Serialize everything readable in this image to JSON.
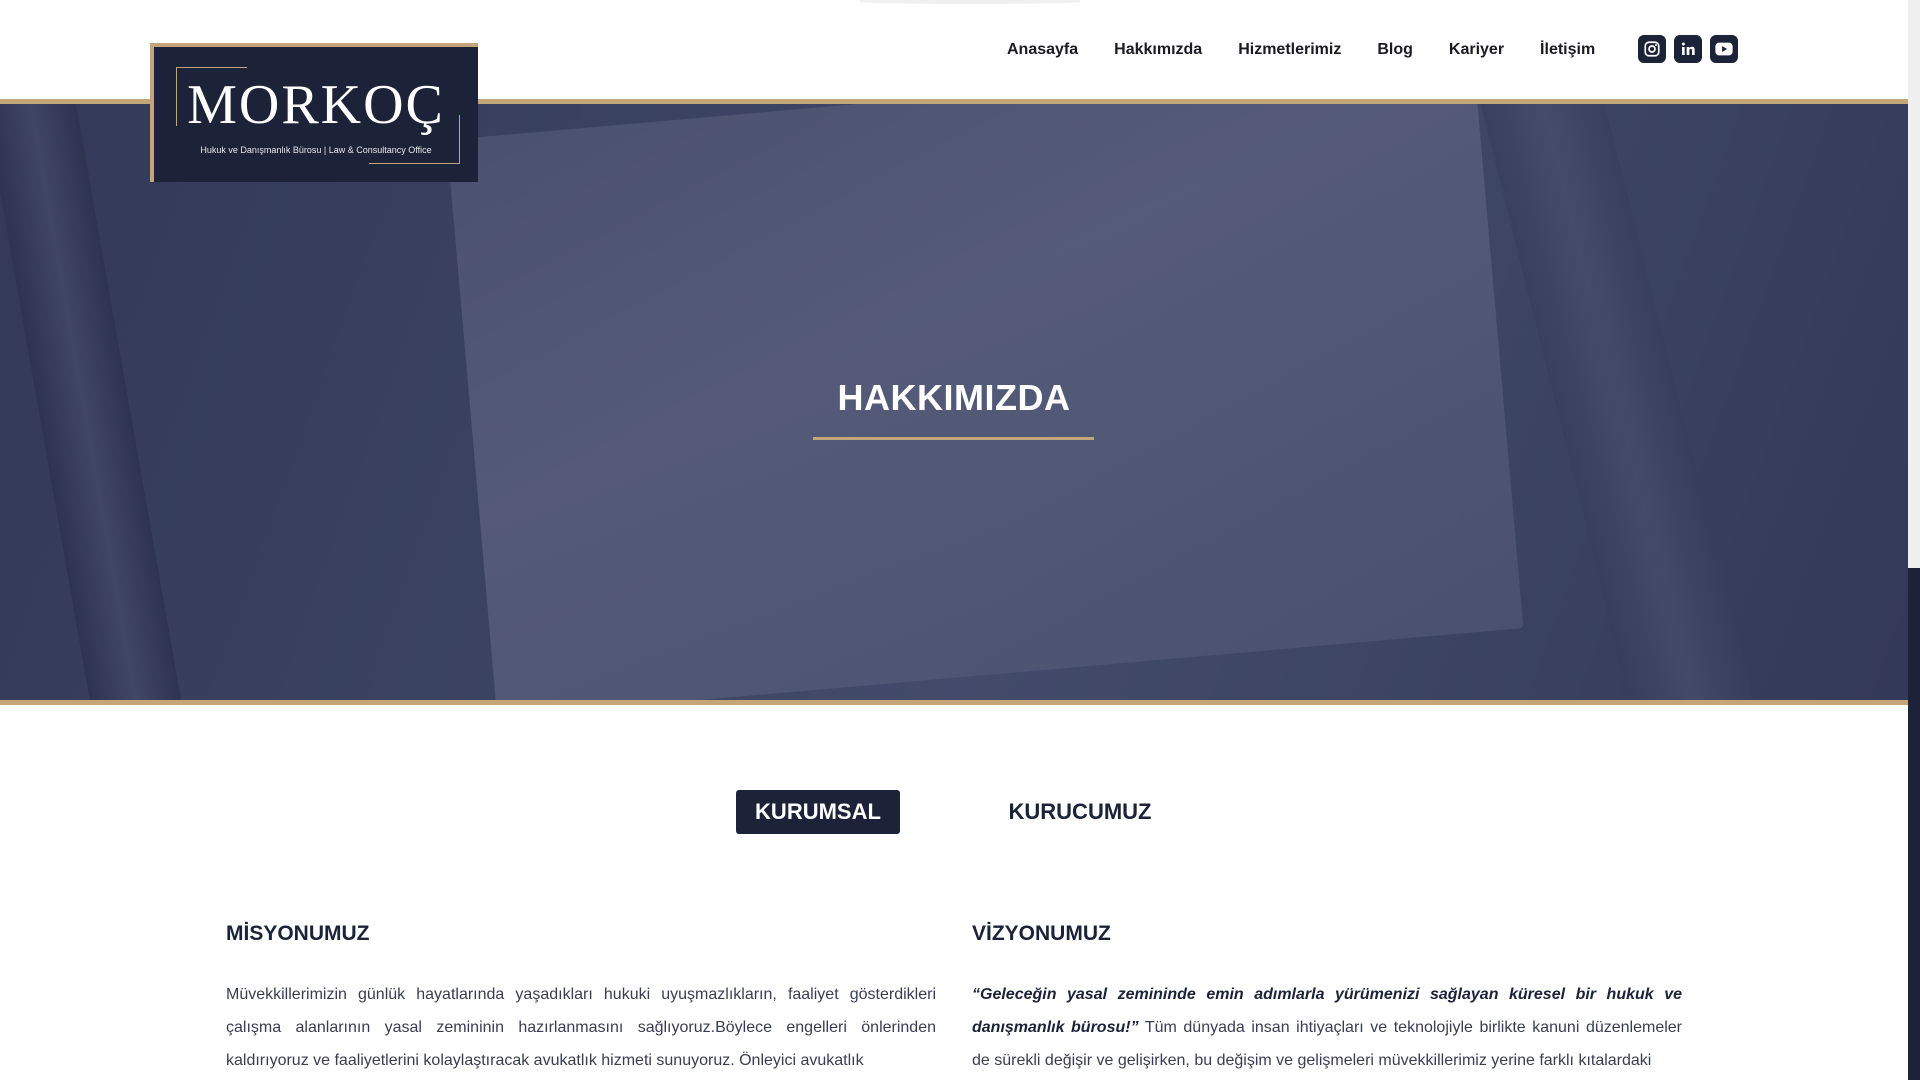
{
  "logo": {
    "name": "MORKOÇ",
    "subtitle": "Hukuk ve Danışmanlık Bürosu | Law & Consultancy Office"
  },
  "nav": {
    "items": [
      {
        "label": "Anasayfa"
      },
      {
        "label": "Hakkımızda"
      },
      {
        "label": "Hizmetlerimiz"
      },
      {
        "label": "Blog"
      },
      {
        "label": "Kariyer"
      },
      {
        "label": "İletişim"
      }
    ]
  },
  "socials": {
    "icons": [
      "instagram-icon",
      "linkedin-icon",
      "youtube-icon"
    ]
  },
  "hero": {
    "title": "HAKKIMIZDA"
  },
  "tabs": {
    "active": "KURUMSAL",
    "inactive": "KURUCUMUZ"
  },
  "mission": {
    "title": "MİSYONUMUZ",
    "text": "Müvekkillerimizin günlük hayatlarında yaşadıkları hukuki uyuşmazlıkların, faaliyet gösterdikleri çalışma alanlarının yasal zemininin hazırlanmasını sağlıyoruz.Böylece engelleri önlerinden kaldırıyoruz ve faaliyetlerini kolaylaştıracak avukatlık hizmeti sunuyoruz. Önleyici avukatlık"
  },
  "vision": {
    "title": "VİZYONUMUZ",
    "quote": "“Geleceğin yasal zemininde emin adımlarla yürümenizi sağlayan küresel bir hukuk ve danışmanlık bürosu!”",
    "text": " Tüm dünyada insan ihtiyaçları ve teknolojiyle birlikte kanuni düzenlemeler de sürekli değişir ve gelişirken, bu değişim ve gelişmeleri müvekkillerimiz yerine farklı kıtalardaki"
  },
  "colors": {
    "navy": "#1c2238",
    "gold": "#c4a57a"
  }
}
